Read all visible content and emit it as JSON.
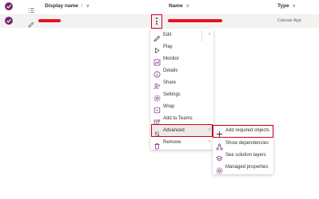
{
  "header": {
    "display_name_label": "Display name",
    "display_name_sort": "↑",
    "name_label": "Name",
    "type_label": "Type"
  },
  "row": {
    "type_value": "Canvas App"
  },
  "context_menu": {
    "items": [
      {
        "label": "Edit",
        "icon": "pencil-icon"
      },
      {
        "label": "Play",
        "icon": "play-icon"
      },
      {
        "label": "Monitor",
        "icon": "monitor-icon"
      },
      {
        "label": "Details",
        "icon": "info-icon"
      },
      {
        "label": "Share",
        "icon": "share-icon"
      },
      {
        "label": "Settings",
        "icon": "gear-icon"
      },
      {
        "label": "Wrap",
        "icon": "wrap-icon"
      },
      {
        "label": "Add to Teams",
        "icon": "teams-icon"
      },
      {
        "label": "Advanced",
        "icon": "advanced-icon"
      },
      {
        "label": "Remove",
        "icon": "trash-icon"
      }
    ]
  },
  "submenu": {
    "items": [
      {
        "label": "Add required objects",
        "icon": "add-icon"
      },
      {
        "label": "Show dependencies",
        "icon": "dependencies-icon"
      },
      {
        "label": "See solution layers",
        "icon": "layers-icon"
      },
      {
        "label": "Managed properties",
        "icon": "gear-icon"
      }
    ]
  },
  "colors": {
    "accent": "#742774",
    "highlight": "#d2001f",
    "redaction": "#e81123"
  }
}
